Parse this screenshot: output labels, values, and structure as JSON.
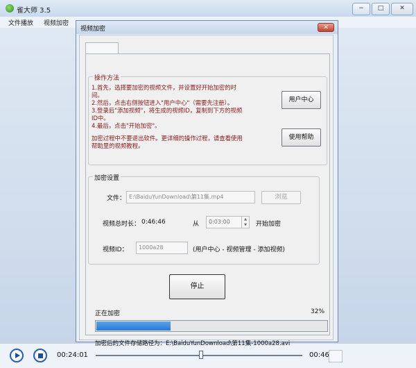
{
  "main": {
    "title": "雀大师 3.5",
    "menu": [
      "文件播放",
      "视频加密"
    ],
    "window_buttons": [
      "−",
      "□",
      "✕"
    ],
    "time_current": "00:24:01",
    "time_total": "00:46",
    "seek_position": 0.51
  },
  "dialog": {
    "title": "视频加密",
    "close_glyph": "✕",
    "how_to": {
      "title": "操作方法",
      "lines": [
        "1.首先，选择要加密的视频文件，并设置好开始加密的时",
        "间。",
        "2.然后，点击右侧按钮进入\"用户中心\"（需要先注册）。",
        "3.登录后\"添加视频\"，将生成的视频ID，复制到下方的视频",
        "ID中。",
        "4.最后，点击\"开始加密\"。",
        "",
        "加密过程中不要退出软件。更详细的操作过程，请查看使用",
        "帮助里的视频教程。"
      ],
      "user_center_button": "用户中心",
      "help_button": "使用帮助"
    },
    "settings": {
      "title": "加密设置",
      "file_label": "文件：",
      "file_value": "E:\\BaiduYunDownload\\第11集.mp4",
      "browse_button": "浏览",
      "duration_label": "视频总时长：",
      "duration_value": "0:46:46",
      "from_label": "从",
      "start_time": "0:03:00",
      "start_label": "开始加密",
      "video_id_label": "视频ID：",
      "video_id_value": "1000a28",
      "video_id_hint": "(用户中心 - 视频管理 - 添加视频)"
    },
    "stop_button": "停止",
    "status_text": "正在加密",
    "progress_percent": "32%",
    "progress_value": 0.32,
    "output_label": "加密后的文件存储路径为：",
    "output_path": "E:\\BaiduYunDownload\\第11集-1000a28.avi"
  }
}
